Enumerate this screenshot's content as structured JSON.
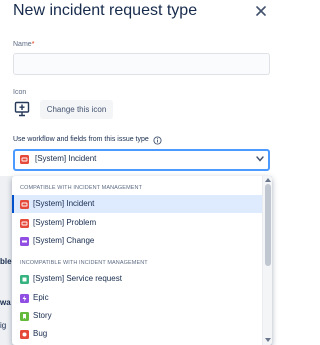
{
  "dialog": {
    "title": "New incident request type",
    "close_icon": "close-icon"
  },
  "form": {
    "name_label": "Name",
    "required_mark": "*",
    "name_value": "",
    "icon_label": "Icon",
    "icon_name": "screen-icon",
    "change_icon_label": "Change this icon",
    "workflow_label": "Use workflow and fields from this issue type",
    "info_icon": "info-icon",
    "selected_value": "[System] Incident",
    "selected_icon_color": "#e5493a"
  },
  "background_fragments": [
    "ble",
    "wa",
    "ig"
  ],
  "dropdown": {
    "groups": [
      {
        "header": "COMPATIBLE WITH INCIDENT MANAGEMENT",
        "options": [
          {
            "label": "[System] Incident",
            "color": "#e5493a",
            "selected": true
          },
          {
            "label": "[System] Problem",
            "color": "#e5493a",
            "selected": false
          },
          {
            "label": "[System] Change",
            "color": "#904ee2",
            "selected": false
          }
        ]
      },
      {
        "header": "INCOMPATIBLE WITH INCIDENT MANAGEMENT",
        "options": [
          {
            "label": "[System] Service request",
            "color": "#36b37e",
            "selected": false
          },
          {
            "label": "Epic",
            "color": "#904ee2",
            "selected": false
          },
          {
            "label": "Story",
            "color": "#63ba3c",
            "selected": false
          },
          {
            "label": "Bug",
            "color": "#e5493a",
            "selected": false
          }
        ]
      }
    ]
  }
}
